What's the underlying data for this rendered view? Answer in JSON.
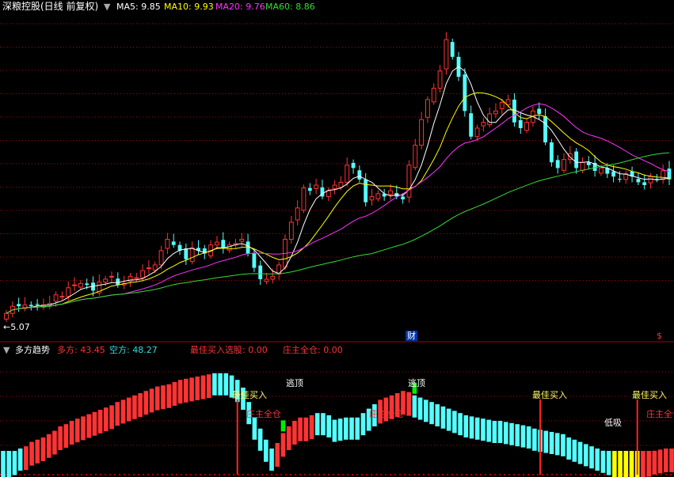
{
  "header": {
    "stock_title": "深粮控股(日线 前复权)",
    "legend": [
      {
        "text": "MA5: 9.85",
        "color": "#ffffff"
      },
      {
        "text": "MA10: 9.93",
        "color": "#ffff00"
      },
      {
        "text": "MA20: 9.76",
        "color": "#ff33ff"
      },
      {
        "text": "MA60: 8.86",
        "color": "#33dd33"
      }
    ]
  },
  "price_panel": {
    "low_price_marker": "5.07",
    "finance_badge": "财",
    "dollar_badge": "$"
  },
  "indicator_header": {
    "name": "多方趋势",
    "items": [
      {
        "text": "多方: 43.45",
        "color": "#ff3333"
      },
      {
        "text": "空方: 48.27",
        "color": "#33dddd"
      },
      {
        "text": "最佳买入选股: 0.00",
        "color": "#ff3333"
      },
      {
        "text": "庄主全仓: 0.00",
        "color": "#ff3333"
      }
    ]
  },
  "annotations": [
    {
      "text": "最佳买入",
      "color": "#ffff66"
    },
    {
      "text": "庄主全仓",
      "color": "#ff3333"
    },
    {
      "text": "逃顶",
      "color": "#ffffff"
    },
    {
      "text": "逃顶",
      "color": "#ffffff"
    },
    {
      "text": "庄主全仓",
      "color": "#ff3333"
    },
    {
      "text": "最佳买入",
      "color": "#ffff66"
    },
    {
      "text": "低吸",
      "color": "#ffffff"
    },
    {
      "text": "最佳买入",
      "color": "#ffff66"
    },
    {
      "text": "庄主全仓",
      "color": "#ff3333"
    }
  ],
  "colors": {
    "up": "#ff3333",
    "down": "#54ffff",
    "ma5": "#ffffff",
    "ma10": "#ffff00",
    "ma20": "#ff33ff",
    "ma60": "#33dd33",
    "grid": "#aa0000",
    "yellow_bar": "#ffff00",
    "green_bar": "#00ee00"
  },
  "chart_data": [
    {
      "type": "candlestick",
      "title": "深粮控股(日线 前复权)",
      "ylim": [
        5.0,
        15.6
      ],
      "close": [
        5.3,
        5.55,
        5.55,
        5.6,
        5.55,
        5.6,
        5.6,
        5.65,
        5.95,
        5.9,
        6.2,
        6.3,
        6.35,
        6.3,
        6.1,
        6.4,
        6.5,
        6.6,
        6.3,
        6.35,
        6.6,
        6.55,
        6.8,
        6.9,
        7.0,
        7.5,
        7.9,
        7.7,
        7.5,
        7.2,
        7.6,
        7.5,
        7.4,
        7.7,
        7.8,
        7.6,
        7.7,
        7.75,
        7.9,
        7.4,
        6.9,
        6.5,
        6.5,
        6.6,
        7.0,
        7.9,
        8.5,
        9.0,
        9.7,
        9.6,
        9.8,
        9.4,
        9.6,
        9.8,
        9.9,
        10.5,
        10.4,
        10.0,
        9.2,
        9.4,
        9.5,
        9.4,
        9.6,
        9.4,
        9.3,
        10.5,
        11.2,
        12.1,
        12.8,
        13.2,
        13.8,
        14.9,
        14.3,
        13.6,
        12.4,
        11.5,
        11.8,
        12.0,
        12.3,
        12.4,
        12.7,
        12.8,
        12.0,
        11.8,
        12.0,
        12.4,
        12.3,
        11.3,
        10.6,
        10.4,
        10.7,
        10.9,
        10.4,
        10.6,
        10.5,
        10.3,
        10.4,
        10.2,
        10.1,
        10.0,
        10.2,
        10.1,
        9.9,
        9.8,
        10.1,
        10.0,
        10.3,
        10.0
      ],
      "series": [
        {
          "name": "MA5",
          "last": 9.85
        },
        {
          "name": "MA10",
          "last": 9.93
        },
        {
          "name": "MA20",
          "last": 9.76
        },
        {
          "name": "MA60",
          "last": 8.86
        }
      ],
      "min_price_label": "5.07"
    },
    {
      "type": "bar",
      "title": "多方趋势",
      "ylim": [
        0,
        100
      ],
      "series": [
        {
          "name": "多方",
          "last": 43.45
        },
        {
          "name": "空方",
          "last": 48.27
        },
        {
          "name": "最佳买入选股",
          "last": 0.0
        },
        {
          "name": "庄主全仓",
          "last": 0.0
        }
      ],
      "values": [
        12,
        14,
        16,
        20,
        22,
        26,
        28,
        30,
        33,
        36,
        40,
        42,
        45,
        47,
        49,
        51,
        53,
        55,
        57,
        59,
        62,
        64,
        66,
        68,
        70,
        72,
        74,
        76,
        77,
        78,
        80,
        82,
        83,
        84,
        85,
        86,
        87,
        88,
        88,
        88,
        86,
        82,
        75,
        62,
        48,
        38,
        28,
        20,
        25,
        34,
        40,
        45,
        48,
        48,
        50,
        52,
        52,
        50,
        46,
        47,
        48,
        48,
        48,
        52,
        56,
        60,
        64,
        66,
        68,
        70,
        72,
        71,
        68,
        66,
        64,
        62,
        60,
        58,
        56,
        54,
        52,
        50,
        49,
        48,
        47,
        46,
        45,
        45,
        44,
        43,
        42,
        41,
        40,
        38,
        37,
        36,
        35,
        34,
        33,
        30,
        28,
        26,
        24,
        22,
        20,
        18,
        16,
        14,
        12,
        10,
        8,
        10,
        13,
        16,
        18,
        19,
        20,
        20
      ],
      "down_indices": [
        0,
        1,
        2,
        3,
        37,
        38,
        39,
        40,
        41,
        42,
        43,
        44,
        45,
        46,
        47,
        55,
        56,
        57,
        58,
        59,
        60,
        61,
        62,
        63,
        64,
        65,
        72,
        73,
        74,
        75,
        76,
        77,
        78,
        79,
        80,
        81,
        82,
        83,
        84,
        85,
        86,
        87,
        88,
        89,
        90,
        91,
        92,
        93,
        94,
        95,
        96,
        97,
        98,
        99,
        100,
        101,
        102,
        103,
        104,
        105,
        106
      ],
      "yellow_indices": [
        107,
        108,
        109,
        110,
        111
      ],
      "green_indices": [
        49,
        72
      ],
      "signal_indices": [
        41,
        94,
        111
      ]
    }
  ]
}
